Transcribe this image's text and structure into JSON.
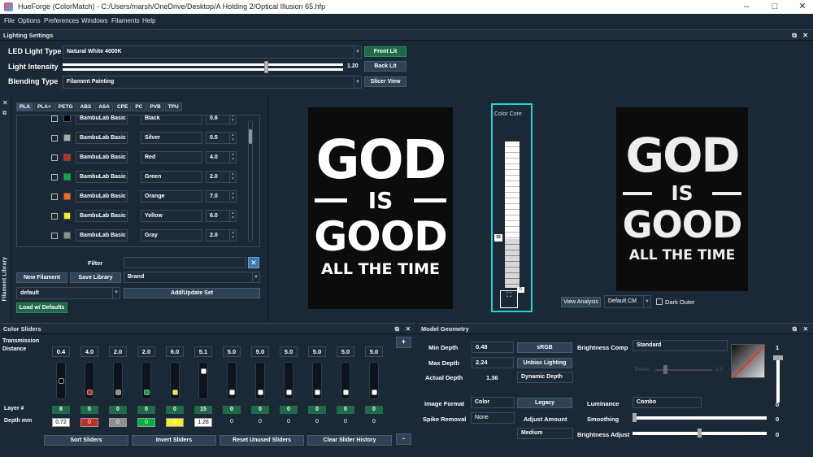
{
  "app": {
    "title": "HueForge (ColorMatch) - C:/Users/marsh/OneDrive/Desktop/A Holding 2/Optical Illusion 65.hfp"
  },
  "menu": [
    "File",
    "Options",
    "Preferences",
    "Windows",
    "Filaments",
    "Help"
  ],
  "lighting": {
    "header": "Lighting Settings",
    "led_label": "LED Light Type",
    "led_value": "Natural White 4000K",
    "intensity_label": "Light Intensity",
    "intensity_value": "1.20",
    "intensity_level": 0.72,
    "blend_label": "Blending Type",
    "blend_value": "Filament Painting",
    "front_lit": "Front Lit",
    "back_lit": "Back Lit",
    "slicer_view": "Slicer View"
  },
  "library": {
    "side_label": "Filament Library",
    "tabs": [
      "PLA",
      "PLA+",
      "PETG",
      "ABS",
      "ASA",
      "CPE",
      "PC",
      "PVB",
      "TPU"
    ],
    "rows": [
      {
        "brand": "BambuLab Basic",
        "name": "Black",
        "td": "0.6",
        "color": "#000000"
      },
      {
        "brand": "BambuLab Basic",
        "name": "Silver",
        "td": "0.5",
        "color": "#a6a9aa"
      },
      {
        "brand": "BambuLab Basic",
        "name": "Red",
        "td": "4.0",
        "color": "#c12e1f"
      },
      {
        "brand": "BambuLab Basic",
        "name": "Green",
        "td": "2.0",
        "color": "#00ae42"
      },
      {
        "brand": "BambuLab Basic",
        "name": "Orange",
        "td": "7.0",
        "color": "#ff6a13"
      },
      {
        "brand": "BambuLab Basic",
        "name": "Yellow",
        "td": "6.0",
        "color": "#f4ee2a"
      },
      {
        "brand": "BambuLab Basic",
        "name": "Gray",
        "td": "2.0",
        "color": "#8e9089"
      }
    ],
    "filter_label": "Filter",
    "new_filament": "New Filament",
    "save_library": "Save Library",
    "brand_value": "Brand",
    "set_value": "default",
    "add_update": "Add/Update Set",
    "load_defaults": "Load w/ Defaults"
  },
  "preview": {
    "line1": "GOD",
    "line2": "IS",
    "line3": "GOOD",
    "line4": "ALL THE TIME",
    "color_core": "Color Core",
    "core_layer": "15",
    "view_analysis": "View Analysis",
    "cm_value": "Default CM",
    "dark_outer": "Dark Outer"
  },
  "sliders": {
    "header": "Color Sliders",
    "td_label": "Transmission Distance",
    "layer_label": "Layer #",
    "depth_label": "Depth mm",
    "cols": [
      {
        "td": "0.4",
        "layer": "8",
        "depth": "0.72",
        "color": "#000000",
        "level": 0.45
      },
      {
        "td": "4.0",
        "layer": "0",
        "depth": "0",
        "color": "#c12e1f",
        "level": 0.0
      },
      {
        "td": "2.0",
        "layer": "0",
        "depth": "0",
        "color": "#8e9089",
        "level": 0.0
      },
      {
        "td": "2.0",
        "layer": "0",
        "depth": "0",
        "color": "#00ae42",
        "level": 0.0
      },
      {
        "td": "6.0",
        "layer": "0",
        "depth": "0",
        "color": "#f4ee2a",
        "level": 0.0
      },
      {
        "td": "5.1",
        "layer": "15",
        "depth": "1.28",
        "color": "#ffffff",
        "level": 0.8
      },
      {
        "td": "5.0",
        "layer": "0",
        "depth": "0",
        "color": "#ffffff",
        "level": 0.0
      },
      {
        "td": "5.0",
        "layer": "0",
        "depth": "0",
        "color": "#ffffff",
        "level": 0.0
      },
      {
        "td": "5.0",
        "layer": "0",
        "depth": "0",
        "color": "#ffffff",
        "level": 0.0
      },
      {
        "td": "5.0",
        "layer": "0",
        "depth": "0",
        "color": "#ffffff",
        "level": 0.0
      },
      {
        "td": "5.0",
        "layer": "0",
        "depth": "0",
        "color": "#ffffff",
        "level": 0.0
      },
      {
        "td": "5.0",
        "layer": "0",
        "depth": "0",
        "color": "#ffffff",
        "level": 0.0
      }
    ],
    "sort": "Sort Sliders",
    "invert": "Invert Sliders",
    "reset": "Reset Unused Sliders",
    "clear": "Clear Slider History",
    "plus": "+",
    "minus": "-"
  },
  "geometry": {
    "header": "Model Geometry",
    "min_depth_label": "Min Depth",
    "min_depth": "0.48",
    "max_depth_label": "Max Depth",
    "max_depth": "2.24",
    "actual_label": "Actual Depth",
    "actual": "1.36",
    "srgb": "sRGB",
    "unbias": "Unbias Lighting",
    "dynamic": "Dynamic Depth",
    "bright_comp_label": "Brightness Comp",
    "bright_comp": "Standard",
    "power_label": "Power",
    "power_val": "2.0",
    "image_format_label": "Image Format",
    "image_format": "Color",
    "legacy": "Legacy",
    "spike_label": "Spike Removal",
    "spike": "None",
    "adjust_amount": "Adjust Amount",
    "medium": "Medium",
    "luminance_label": "Luminance",
    "luminance": "Combo",
    "smoothing_label": "Smoothing",
    "bright_adjust_label": "Brightness Adjust",
    "v1": "1",
    "v2": "0",
    "v3": "0",
    "v4": "0",
    "v5": "0"
  }
}
